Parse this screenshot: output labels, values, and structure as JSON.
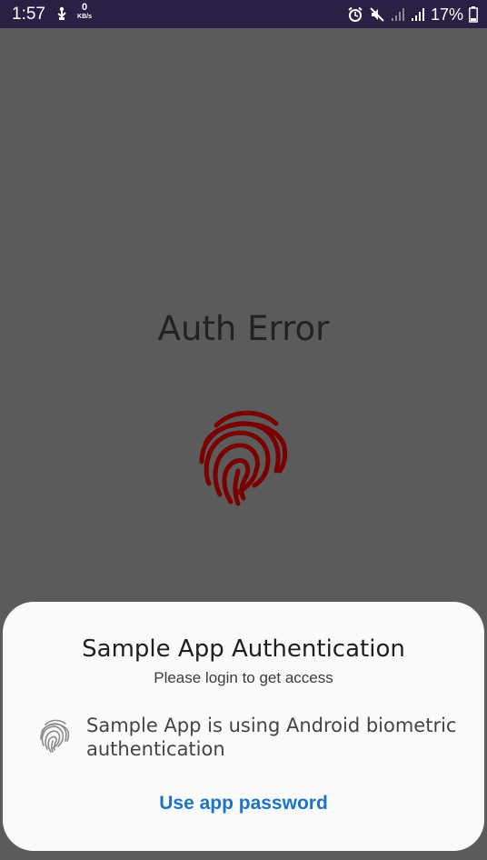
{
  "status_bar": {
    "time": "1:57",
    "net_speed_value": "0",
    "net_speed_unit": "KB/s",
    "battery": "17%",
    "background_color": "#2a1f45",
    "icons": [
      "usb-icon",
      "alarm-icon",
      "mute-icon",
      "signal-icon",
      "signal-icon",
      "battery-icon"
    ]
  },
  "background": {
    "title": "Auth Error",
    "fingerprint_color": "#7a0000",
    "icon": "fingerprint-icon"
  },
  "biometric_prompt": {
    "title": "Sample App Authentication",
    "subtitle": "Please login to get access",
    "description": "Sample App is using Android biometric authentication",
    "icon": "fingerprint-icon",
    "negative_button": "Use app password",
    "accent_color": "#1b74c5"
  }
}
